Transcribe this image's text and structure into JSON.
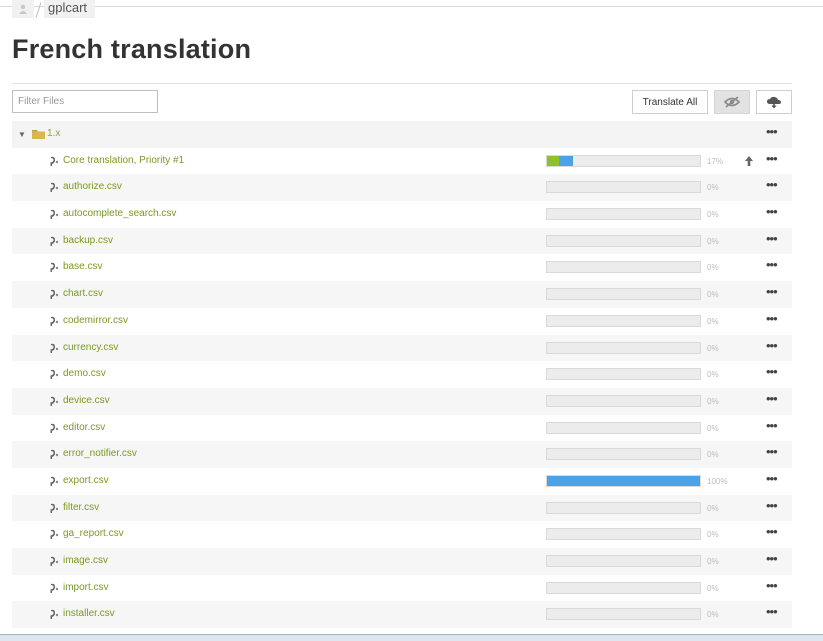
{
  "breadcrumb": {
    "project": "gplcart"
  },
  "page": {
    "title": "French translation"
  },
  "toolbar": {
    "filter_placeholder": "Filter Files",
    "translate_all_label": "Translate All",
    "hide_icon": "eye-slash-icon",
    "cloud_icon": "cloud-download-icon"
  },
  "colors": {
    "link": "#7a9a22",
    "bar_blue": "#4aa3e8",
    "bar_green": "#8ec12a"
  },
  "folder": {
    "name": "1.x"
  },
  "files": [
    {
      "name": "Core translation, Priority #1",
      "pct": "17%",
      "green": 0.08,
      "blue": 0.09,
      "pinned": true
    },
    {
      "name": "authorize.csv",
      "pct": "0%",
      "green": 0,
      "blue": 0
    },
    {
      "name": "autocomplete_search.csv",
      "pct": "0%",
      "green": 0,
      "blue": 0
    },
    {
      "name": "backup.csv",
      "pct": "0%",
      "green": 0,
      "blue": 0
    },
    {
      "name": "base.csv",
      "pct": "0%",
      "green": 0,
      "blue": 0
    },
    {
      "name": "chart.csv",
      "pct": "0%",
      "green": 0,
      "blue": 0
    },
    {
      "name": "codemirror.csv",
      "pct": "0%",
      "green": 0,
      "blue": 0
    },
    {
      "name": "currency.csv",
      "pct": "0%",
      "green": 0,
      "blue": 0
    },
    {
      "name": "demo.csv",
      "pct": "0%",
      "green": 0,
      "blue": 0
    },
    {
      "name": "device.csv",
      "pct": "0%",
      "green": 0,
      "blue": 0
    },
    {
      "name": "editor.csv",
      "pct": "0%",
      "green": 0,
      "blue": 0
    },
    {
      "name": "error_notifier.csv",
      "pct": "0%",
      "green": 0,
      "blue": 0
    },
    {
      "name": "export.csv",
      "pct": "100%",
      "green": 0,
      "blue": 1.0
    },
    {
      "name": "filter.csv",
      "pct": "0%",
      "green": 0,
      "blue": 0
    },
    {
      "name": "ga_report.csv",
      "pct": "0%",
      "green": 0,
      "blue": 0
    },
    {
      "name": "image.csv",
      "pct": "0%",
      "green": 0,
      "blue": 0
    },
    {
      "name": "import.csv",
      "pct": "0%",
      "green": 0,
      "blue": 0
    },
    {
      "name": "installer.csv",
      "pct": "0%",
      "green": 0,
      "blue": 0
    }
  ],
  "row_menu_icon": "ellipsis-icon"
}
